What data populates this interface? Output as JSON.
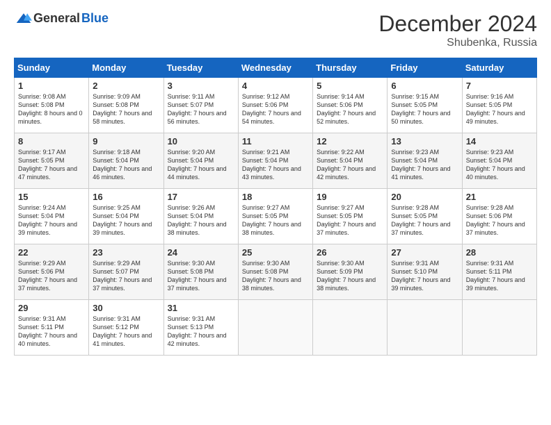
{
  "header": {
    "logo_general": "General",
    "logo_blue": "Blue",
    "title": "December 2024",
    "location": "Shubenka, Russia"
  },
  "days_of_week": [
    "Sunday",
    "Monday",
    "Tuesday",
    "Wednesday",
    "Thursday",
    "Friday",
    "Saturday"
  ],
  "weeks": [
    [
      {
        "day": "1",
        "sunrise": "Sunrise: 9:08 AM",
        "sunset": "Sunset: 5:08 PM",
        "daylight": "Daylight: 8 hours and 0 minutes."
      },
      {
        "day": "2",
        "sunrise": "Sunrise: 9:09 AM",
        "sunset": "Sunset: 5:08 PM",
        "daylight": "Daylight: 7 hours and 58 minutes."
      },
      {
        "day": "3",
        "sunrise": "Sunrise: 9:11 AM",
        "sunset": "Sunset: 5:07 PM",
        "daylight": "Daylight: 7 hours and 56 minutes."
      },
      {
        "day": "4",
        "sunrise": "Sunrise: 9:12 AM",
        "sunset": "Sunset: 5:06 PM",
        "daylight": "Daylight: 7 hours and 54 minutes."
      },
      {
        "day": "5",
        "sunrise": "Sunrise: 9:14 AM",
        "sunset": "Sunset: 5:06 PM",
        "daylight": "Daylight: 7 hours and 52 minutes."
      },
      {
        "day": "6",
        "sunrise": "Sunrise: 9:15 AM",
        "sunset": "Sunset: 5:05 PM",
        "daylight": "Daylight: 7 hours and 50 minutes."
      },
      {
        "day": "7",
        "sunrise": "Sunrise: 9:16 AM",
        "sunset": "Sunset: 5:05 PM",
        "daylight": "Daylight: 7 hours and 49 minutes."
      }
    ],
    [
      {
        "day": "8",
        "sunrise": "Sunrise: 9:17 AM",
        "sunset": "Sunset: 5:05 PM",
        "daylight": "Daylight: 7 hours and 47 minutes."
      },
      {
        "day": "9",
        "sunrise": "Sunrise: 9:18 AM",
        "sunset": "Sunset: 5:04 PM",
        "daylight": "Daylight: 7 hours and 46 minutes."
      },
      {
        "day": "10",
        "sunrise": "Sunrise: 9:20 AM",
        "sunset": "Sunset: 5:04 PM",
        "daylight": "Daylight: 7 hours and 44 minutes."
      },
      {
        "day": "11",
        "sunrise": "Sunrise: 9:21 AM",
        "sunset": "Sunset: 5:04 PM",
        "daylight": "Daylight: 7 hours and 43 minutes."
      },
      {
        "day": "12",
        "sunrise": "Sunrise: 9:22 AM",
        "sunset": "Sunset: 5:04 PM",
        "daylight": "Daylight: 7 hours and 42 minutes."
      },
      {
        "day": "13",
        "sunrise": "Sunrise: 9:23 AM",
        "sunset": "Sunset: 5:04 PM",
        "daylight": "Daylight: 7 hours and 41 minutes."
      },
      {
        "day": "14",
        "sunrise": "Sunrise: 9:23 AM",
        "sunset": "Sunset: 5:04 PM",
        "daylight": "Daylight: 7 hours and 40 minutes."
      }
    ],
    [
      {
        "day": "15",
        "sunrise": "Sunrise: 9:24 AM",
        "sunset": "Sunset: 5:04 PM",
        "daylight": "Daylight: 7 hours and 39 minutes."
      },
      {
        "day": "16",
        "sunrise": "Sunrise: 9:25 AM",
        "sunset": "Sunset: 5:04 PM",
        "daylight": "Daylight: 7 hours and 39 minutes."
      },
      {
        "day": "17",
        "sunrise": "Sunrise: 9:26 AM",
        "sunset": "Sunset: 5:04 PM",
        "daylight": "Daylight: 7 hours and 38 minutes."
      },
      {
        "day": "18",
        "sunrise": "Sunrise: 9:27 AM",
        "sunset": "Sunset: 5:05 PM",
        "daylight": "Daylight: 7 hours and 38 minutes."
      },
      {
        "day": "19",
        "sunrise": "Sunrise: 9:27 AM",
        "sunset": "Sunset: 5:05 PM",
        "daylight": "Daylight: 7 hours and 37 minutes."
      },
      {
        "day": "20",
        "sunrise": "Sunrise: 9:28 AM",
        "sunset": "Sunset: 5:05 PM",
        "daylight": "Daylight: 7 hours and 37 minutes."
      },
      {
        "day": "21",
        "sunrise": "Sunrise: 9:28 AM",
        "sunset": "Sunset: 5:06 PM",
        "daylight": "Daylight: 7 hours and 37 minutes."
      }
    ],
    [
      {
        "day": "22",
        "sunrise": "Sunrise: 9:29 AM",
        "sunset": "Sunset: 5:06 PM",
        "daylight": "Daylight: 7 hours and 37 minutes."
      },
      {
        "day": "23",
        "sunrise": "Sunrise: 9:29 AM",
        "sunset": "Sunset: 5:07 PM",
        "daylight": "Daylight: 7 hours and 37 minutes."
      },
      {
        "day": "24",
        "sunrise": "Sunrise: 9:30 AM",
        "sunset": "Sunset: 5:08 PM",
        "daylight": "Daylight: 7 hours and 37 minutes."
      },
      {
        "day": "25",
        "sunrise": "Sunrise: 9:30 AM",
        "sunset": "Sunset: 5:08 PM",
        "daylight": "Daylight: 7 hours and 38 minutes."
      },
      {
        "day": "26",
        "sunrise": "Sunrise: 9:30 AM",
        "sunset": "Sunset: 5:09 PM",
        "daylight": "Daylight: 7 hours and 38 minutes."
      },
      {
        "day": "27",
        "sunrise": "Sunrise: 9:31 AM",
        "sunset": "Sunset: 5:10 PM",
        "daylight": "Daylight: 7 hours and 39 minutes."
      },
      {
        "day": "28",
        "sunrise": "Sunrise: 9:31 AM",
        "sunset": "Sunset: 5:11 PM",
        "daylight": "Daylight: 7 hours and 39 minutes."
      }
    ],
    [
      {
        "day": "29",
        "sunrise": "Sunrise: 9:31 AM",
        "sunset": "Sunset: 5:11 PM",
        "daylight": "Daylight: 7 hours and 40 minutes."
      },
      {
        "day": "30",
        "sunrise": "Sunrise: 9:31 AM",
        "sunset": "Sunset: 5:12 PM",
        "daylight": "Daylight: 7 hours and 41 minutes."
      },
      {
        "day": "31",
        "sunrise": "Sunrise: 9:31 AM",
        "sunset": "Sunset: 5:13 PM",
        "daylight": "Daylight: 7 hours and 42 minutes."
      },
      null,
      null,
      null,
      null
    ]
  ]
}
